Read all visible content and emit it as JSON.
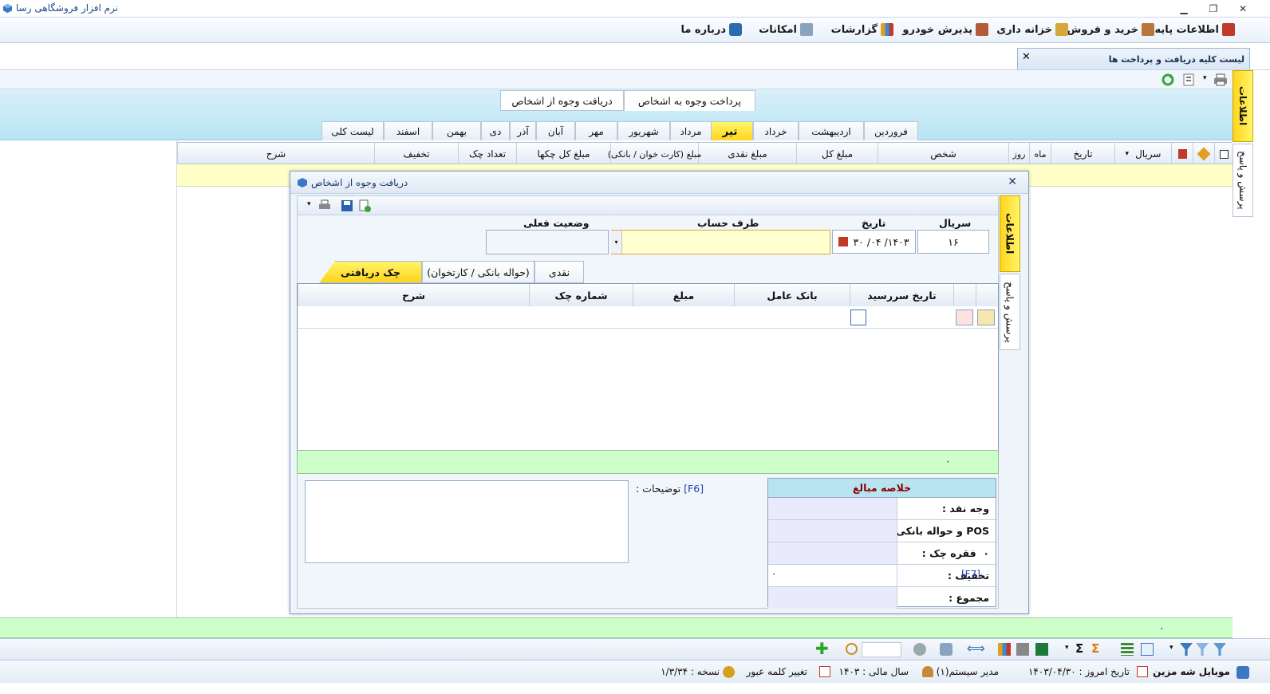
{
  "window": {
    "title": "نرم افزار فروشگاهی رسا",
    "minimize": "▁",
    "restore": "❐",
    "close": "✕"
  },
  "menu": [
    {
      "label": "اطلاعات پایه",
      "icon": "book-icon",
      "color": "#c0392b"
    },
    {
      "label": "خرید و فروش",
      "icon": "box-icon",
      "color": "#b7773b"
    },
    {
      "label": "خزانه داری",
      "icon": "safe-icon",
      "color": "#d4a73a"
    },
    {
      "label": "پذیرش خودرو",
      "icon": "car-box-icon",
      "color": "#b35a3a"
    },
    {
      "label": "گزارشات",
      "icon": "bar-chart-icon",
      "color": "#e0a020"
    },
    {
      "label": "امکانات",
      "icon": "tools-icon",
      "color": "#5a7a9a"
    },
    {
      "label": "درباره ما",
      "icon": "cube-icon",
      "color": "#2b6cb0"
    }
  ],
  "doc_tab": {
    "label": "لیست کلیه دریافت و پرداخت ها",
    "close": "✕"
  },
  "side_tabs": {
    "info": "اطلاعات",
    "qa": "پرسش و پاسخ"
  },
  "segments": {
    "pay": "پرداخت وجوه به اشخاص",
    "receive": "دریافت وجوه از اشخاص"
  },
  "months": [
    "فروردین",
    "اردیبهشت",
    "خرداد",
    "تیر",
    "مرداد",
    "شهریور",
    "مهر",
    "آبان",
    "آذر",
    "دی",
    "بهمن",
    "اسفند",
    "لیست کلی"
  ],
  "active_month": "تیر",
  "grid_columns": [
    "سریال",
    "تاریخ",
    "ماه",
    "روز",
    "شخص",
    "مبلغ کل",
    "مبلغ نقدی",
    "مبلغ (کارت خوان / بانکی)",
    "مبلغ کل چکها",
    "تعداد چک",
    "تخفیف",
    "شرح"
  ],
  "grid_footer": "۰",
  "dialog": {
    "title": "دریافت وجوه از اشخاص",
    "close": "✕",
    "serial_label": "سریال",
    "serial_value": "۱۶",
    "date_label": "تاریخ",
    "date_value": "۱۴۰۳/ ۰۴/ ۳۰",
    "party_label": "طرف حساب",
    "party_value": "",
    "status_label": "وضعیت فعلی",
    "status_value": "",
    "pay_tabs": [
      "نقدی",
      "(حواله بانکی / کارتخوان)",
      "چک دریافتی"
    ],
    "active_pay_tab": "چک دریافتی",
    "check_columns": [
      "تاریخ سررسید",
      "بانک عامل",
      "مبلغ",
      "شماره چک",
      "شرح"
    ],
    "check_footer": "۰",
    "notes_label": "توضیحات :",
    "notes_key": "[F6]",
    "notes_value": "",
    "summary": {
      "title": "خلاصه مبالغ",
      "cash_label": "وجه نقد :",
      "pos_label": "POS و حواله بانکی :",
      "checks_label": "فقره چک :",
      "checks_count": "۰",
      "discount_label": "تخفیف :",
      "discount_key": "[F7]",
      "discount_value": "۰",
      "total_label": "مجموع :"
    }
  },
  "status": {
    "company": "موبایل شه مزین",
    "today_label": "تاریخ امروز :",
    "today_value": "۱۴۰۳/۰۴/۳۰",
    "user": "مدیر سیستم(۱)",
    "fiscal_label": "سال مالی :",
    "fiscal_value": "۱۴۰۳",
    "change_password": "تغییر کلمه عبور",
    "version_label": "نسخه :",
    "version_value": "۱/۳/۳۴"
  },
  "colors": {
    "accent": "#ffd51c",
    "panel": "#b8e4f4",
    "footer": "#ccffc9",
    "row": "#ffffc8"
  }
}
